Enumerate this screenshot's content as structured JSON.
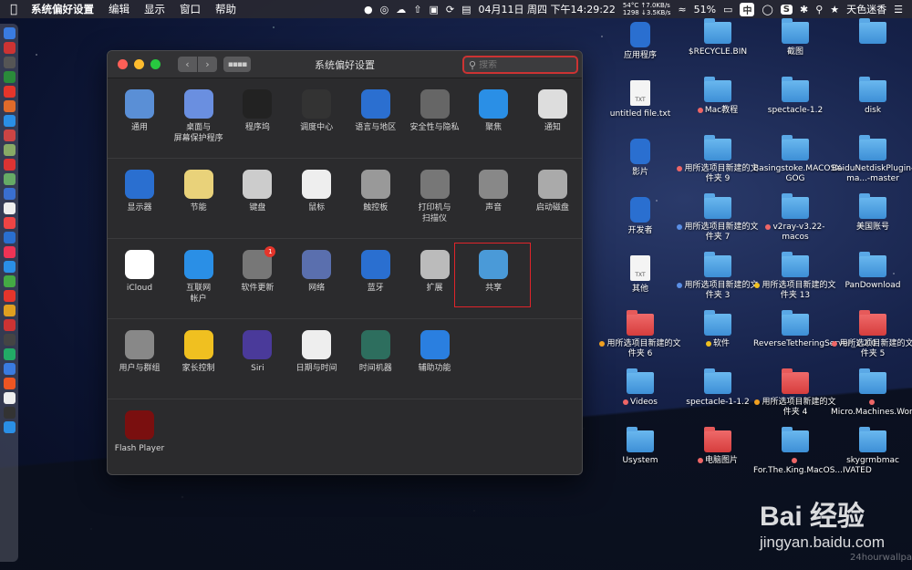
{
  "menubar": {
    "app": "系统偏好设置",
    "menus": [
      "编辑",
      "显示",
      "窗口",
      "帮助"
    ],
    "temp": "54°C",
    "fan": "1298",
    "net_up": "↑7.0KB/s",
    "net_down": "↓3.5KB/s",
    "datetime": "04月11日 周四 下午14:29:22",
    "battery": "51%",
    "input_method": "中",
    "user": "天色迷香"
  },
  "window": {
    "title": "系统偏好设置",
    "search_placeholder": "搜索",
    "sections": [
      [
        {
          "label": "通用",
          "icon": "general-icon",
          "color": "#5a8fd6"
        },
        {
          "label": "桌面与\n屏幕保护程序",
          "icon": "desktop-icon",
          "color": "#6a8fe0"
        },
        {
          "label": "程序坞",
          "icon": "dock-icon",
          "color": "#222"
        },
        {
          "label": "调度中心",
          "icon": "mission-control-icon",
          "color": "#333"
        },
        {
          "label": "语言与地区",
          "icon": "flag-icon",
          "color": "#2b6fd0"
        },
        {
          "label": "安全性与隐私",
          "icon": "house-lock-icon",
          "color": "#666"
        },
        {
          "label": "聚焦",
          "icon": "search-icon",
          "color": "#2a8fe6"
        },
        {
          "label": "通知",
          "icon": "notification-icon",
          "color": "#ddd"
        }
      ],
      [
        {
          "label": "显示器",
          "icon": "display-icon",
          "color": "#2a6fd0"
        },
        {
          "label": "节能",
          "icon": "bulb-icon",
          "color": "#e9d27a"
        },
        {
          "label": "键盘",
          "icon": "keyboard-icon",
          "color": "#ccc"
        },
        {
          "label": "鼠标",
          "icon": "mouse-icon",
          "color": "#eee"
        },
        {
          "label": "触控板",
          "icon": "trackpad-icon",
          "color": "#999"
        },
        {
          "label": "打印机与\n扫描仪",
          "icon": "printer-icon",
          "color": "#777"
        },
        {
          "label": "声音",
          "icon": "speaker-icon",
          "color": "#888"
        },
        {
          "label": "启动磁盘",
          "icon": "disk-icon",
          "color": "#aaa"
        }
      ],
      [
        {
          "label": "iCloud",
          "icon": "icloud-icon",
          "color": "#fff"
        },
        {
          "label": "互联网\n帐户",
          "icon": "at-icon",
          "color": "#2a8fe6"
        },
        {
          "label": "软件更新",
          "icon": "gear-icon",
          "color": "#777",
          "badge": "1"
        },
        {
          "label": "网络",
          "icon": "globe-icon",
          "color": "#5a6fae"
        },
        {
          "label": "蓝牙",
          "icon": "bluetooth-icon",
          "color": "#2a6fd0"
        },
        {
          "label": "扩展",
          "icon": "puzzle-icon",
          "color": "#bbb"
        },
        {
          "label": "共享",
          "icon": "sharing-folder-icon",
          "color": "#4a9ad8"
        }
      ],
      [
        {
          "label": "用户与群组",
          "icon": "users-icon",
          "color": "#888"
        },
        {
          "label": "家长控制",
          "icon": "parental-icon",
          "color": "#f0c020"
        },
        {
          "label": "Siri",
          "icon": "siri-icon",
          "color": "#4a3a9a"
        },
        {
          "label": "日期与时间",
          "icon": "clock-icon",
          "color": "#eee"
        },
        {
          "label": "时间机器",
          "icon": "time-machine-icon",
          "color": "#2d6e5e"
        },
        {
          "label": "辅助功能",
          "icon": "accessibility-icon",
          "color": "#2a7fe0"
        }
      ],
      [
        {
          "label": "Flash Player",
          "icon": "flash-icon",
          "color": "#7a0f0f"
        }
      ]
    ]
  },
  "desktop": {
    "icons": [
      {
        "label": "应用程序",
        "type": "app"
      },
      {
        "label": "$RECYCLE.BIN",
        "type": "folder"
      },
      {
        "label": "截图",
        "type": "folder"
      },
      {
        "label": "",
        "type": "folder"
      },
      {
        "label": "untitled file.txt",
        "type": "doc"
      },
      {
        "label": "Mac教程",
        "type": "folder",
        "dot": "#e66"
      },
      {
        "label": "spectacle-1.2",
        "type": "folder"
      },
      {
        "label": "disk",
        "type": "folder"
      },
      {
        "label": "影片",
        "type": "app"
      },
      {
        "label": "用所选项目新建的文件夹 9",
        "type": "folder",
        "dot": "#e66"
      },
      {
        "label": "Basingstoke.MACOSX-GOG",
        "type": "folder"
      },
      {
        "label": "BaiduNetdiskPlugin-ma...-master",
        "type": "folder"
      },
      {
        "label": "开发者",
        "type": "app"
      },
      {
        "label": "用所选项目新建的文件夹 7",
        "type": "folder",
        "dot": "#5a8fe6"
      },
      {
        "label": "v2ray-v3.22-macos",
        "type": "folder",
        "dot": "#e66"
      },
      {
        "label": "美国账号",
        "type": "folder"
      },
      {
        "label": "其他",
        "type": "doc"
      },
      {
        "label": "用所选项目新建的文件夹 3",
        "type": "folder",
        "dot": "#5a8fe6"
      },
      {
        "label": "用所选项目新建的文件夹 13",
        "type": "folder",
        "dot": "#f0c020"
      },
      {
        "label": "PanDownload",
        "type": "folder"
      },
      {
        "label": "用所选项目新建的文件夹 6",
        "type": "red",
        "dot": "#f0a020"
      },
      {
        "label": "软件",
        "type": "folder",
        "dot": "#f0c020"
      },
      {
        "label": "ReverseTetheringServer_1.2.0",
        "type": "folder"
      },
      {
        "label": "用所选项目新建的文件夹 5",
        "type": "red",
        "dot": "#e66"
      },
      {
        "label": "Videos",
        "type": "folder",
        "dot": "#e66"
      },
      {
        "label": "spectacle-1-1.2",
        "type": "folder"
      },
      {
        "label": "用所选项目新建的文件夹 4",
        "type": "red",
        "dot": "#f0a020"
      },
      {
        "label": "Micro.Machines.Worl...IVATED",
        "type": "folder",
        "dot": "#e66"
      },
      {
        "label": "Usystem",
        "type": "folder"
      },
      {
        "label": "电脑图片",
        "type": "red",
        "dot": "#e66"
      },
      {
        "label": "For.The.King.MacOS...IVATED",
        "type": "folder",
        "dot": "#e66"
      },
      {
        "label": "skygrmbmac",
        "type": "folder"
      }
    ]
  },
  "watermark": {
    "logo": "Bai 经验",
    "url": "jingyan.baidu.com",
    "credit": "24hourwallpa"
  }
}
